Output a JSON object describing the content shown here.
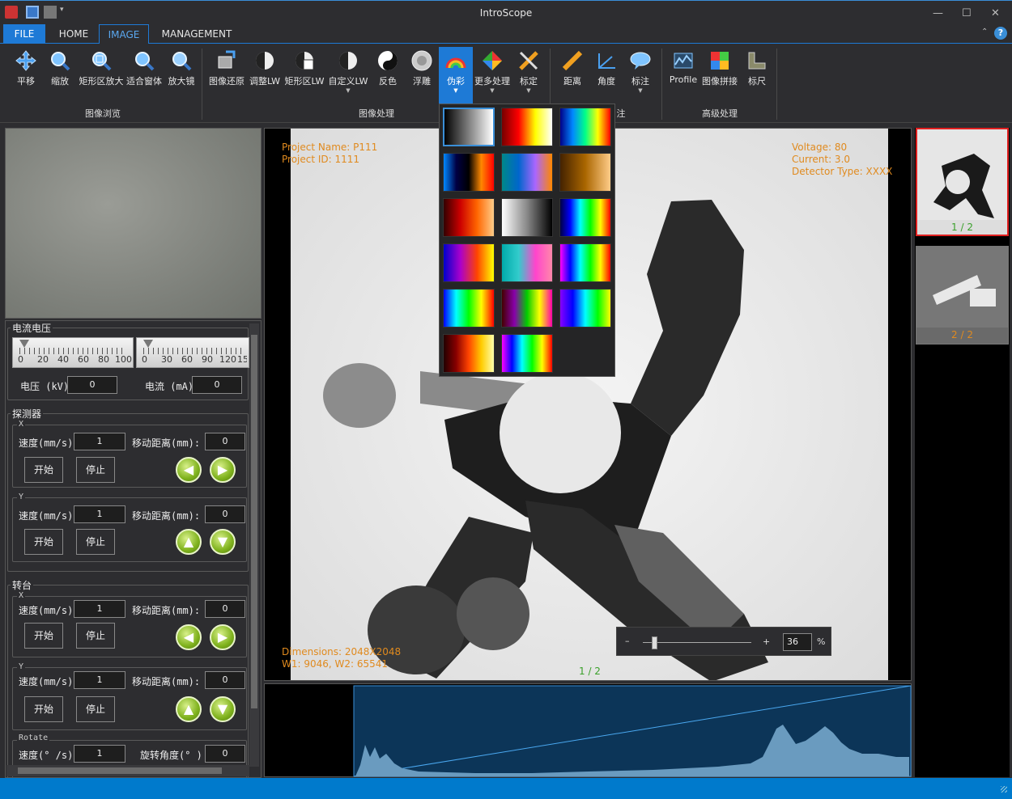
{
  "app": {
    "title": "IntroScope"
  },
  "tabs": [
    {
      "label": "FILE"
    },
    {
      "label": "HOME"
    },
    {
      "label": "IMAGE"
    },
    {
      "label": "MANAGEMENT"
    }
  ],
  "ribbon": {
    "items": [
      {
        "label": "平移",
        "icon": "pan-arrows-icon"
      },
      {
        "label": "缩放",
        "icon": "zoom-icon"
      },
      {
        "label": "矩形区放大",
        "icon": "rect-zoom-icon"
      },
      {
        "label": "适合窗体",
        "icon": "fit-window-icon"
      },
      {
        "label": "放大镜",
        "icon": "magnifier-icon"
      },
      {
        "label": "图像还原",
        "icon": "image-restore-icon"
      },
      {
        "label": "调整LW",
        "icon": "adjust-lw-icon"
      },
      {
        "label": "矩形区LW",
        "icon": "rect-lw-icon"
      },
      {
        "label": "自定义LW",
        "icon": "custom-lw-icon"
      },
      {
        "label": "反色",
        "icon": "invert-icon"
      },
      {
        "label": "浮雕",
        "icon": "emboss-icon"
      },
      {
        "label": "伪彩",
        "icon": "pseudo-color-icon"
      },
      {
        "label": "更多处理",
        "icon": "more-processing-icon"
      },
      {
        "label": "标定",
        "icon": "calibrate-icon"
      },
      {
        "label": "距离",
        "icon": "distance-icon"
      },
      {
        "label": "角度",
        "icon": "angle-icon"
      },
      {
        "label": "标注",
        "icon": "annotate-icon"
      },
      {
        "label": "Profile",
        "icon": "profile-icon"
      },
      {
        "label": "图像拼接",
        "icon": "image-stitch-icon"
      },
      {
        "label": "标尺",
        "icon": "ruler-icon"
      }
    ],
    "groups": {
      "browse": "图像浏览",
      "process": "图像处理",
      "annotate_partial": "注",
      "advanced": "高级处理"
    }
  },
  "controls": {
    "power": {
      "title": "电流电压",
      "voltage_ticks": [
        "0",
        "20",
        "40",
        "60",
        "80",
        "100"
      ],
      "current_ticks": [
        "0",
        "30",
        "60",
        "90",
        "120",
        "15"
      ],
      "voltage_label": "电压 (kV)",
      "voltage_value": "0",
      "current_label": "电流 (mA)",
      "current_value": "0"
    },
    "detector": {
      "title": "探测器",
      "x": {
        "axis": "X",
        "speed_label": "速度(mm/s)",
        "speed": "1",
        "dist_label": "移动距离(mm):",
        "dist": "0",
        "start": "开始",
        "stop": "停止"
      },
      "y": {
        "axis": "Y",
        "speed_label": "速度(mm/s)",
        "speed": "1",
        "dist_label": "移动距离(mm):",
        "dist": "0",
        "start": "开始",
        "stop": "停止"
      }
    },
    "turntable": {
      "title": "转台",
      "x": {
        "axis": "X",
        "speed_label": "速度(mm/s)",
        "speed": "1",
        "dist_label": "移动距离(mm):",
        "dist": "0",
        "start": "开始",
        "stop": "停止"
      },
      "y": {
        "axis": "Y",
        "speed_label": "速度(mm/s)",
        "speed": "1",
        "dist_label": "移动距离(mm):",
        "dist": "0",
        "start": "开始",
        "stop": "停止"
      },
      "rotate": {
        "title": "Rotate",
        "speed_label": "速度(° /s)",
        "speed": "1",
        "angle_label": "旋转角度(° )",
        "angle": "0"
      }
    }
  },
  "viewer": {
    "project_name": "Project Name: P111",
    "project_id": "Project ID: 1111",
    "voltage": "Voltage: 80",
    "current": "Current: 3.0",
    "detector_type": "Detector Type: XXXX",
    "dimensions": "Dimensions: 2048X2048",
    "window": "W1: 9046, W2: 65541",
    "page": "1 / 2",
    "zoom_minus": "–",
    "zoom_plus": "+",
    "zoom_value": "36",
    "zoom_unit": "%",
    "zoom_level": 0.08
  },
  "thumbnails": [
    {
      "label": "1 / 2"
    },
    {
      "label": "2 / 2"
    }
  ],
  "colors": {
    "accent": "#007acc",
    "overlay": "#e08a1e",
    "selected_thumb": "#e02020",
    "page_green": "#3aa02a"
  }
}
